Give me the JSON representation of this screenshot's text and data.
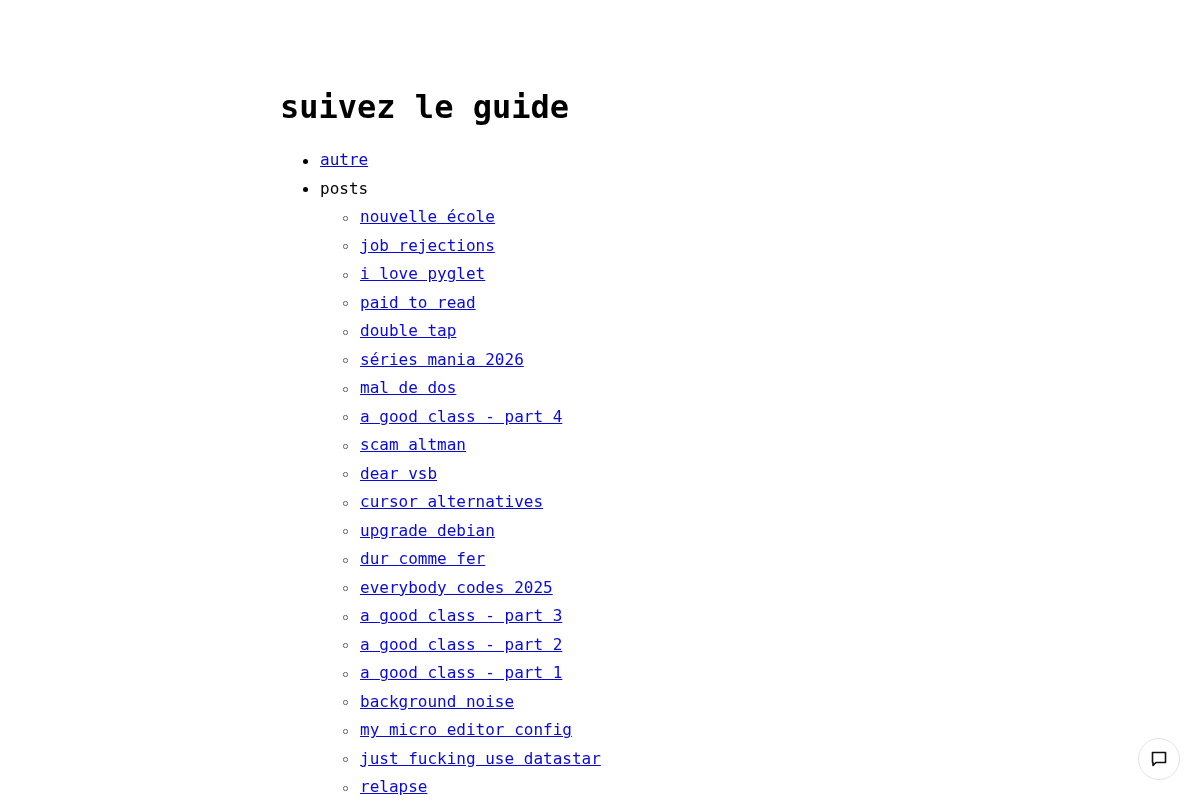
{
  "page": {
    "title": "suivez le guide"
  },
  "nav": [
    {
      "label": "autre",
      "kind": "link"
    },
    {
      "label": "posts",
      "kind": "label",
      "children": [
        {
          "label": "nouvelle école",
          "kind": "link"
        },
        {
          "label": "job rejections",
          "kind": "link"
        },
        {
          "label": "i love pyglet",
          "kind": "link"
        },
        {
          "label": "paid to read",
          "kind": "link"
        },
        {
          "label": "double tap",
          "kind": "link"
        },
        {
          "label": "séries mania 2026",
          "kind": "link"
        },
        {
          "label": "mal de dos",
          "kind": "link"
        },
        {
          "label": "a good class - part 4",
          "kind": "link"
        },
        {
          "label": "scam altman",
          "kind": "link"
        },
        {
          "label": "dear vsb",
          "kind": "link"
        },
        {
          "label": "cursor alternatives",
          "kind": "link"
        },
        {
          "label": "upgrade debian",
          "kind": "link"
        },
        {
          "label": "dur comme fer",
          "kind": "link"
        },
        {
          "label": "everybody codes 2025",
          "kind": "link"
        },
        {
          "label": "a good class - part 3",
          "kind": "link"
        },
        {
          "label": "a good class - part 2",
          "kind": "link"
        },
        {
          "label": "a good class - part 1",
          "kind": "link"
        },
        {
          "label": "background noise",
          "kind": "link"
        },
        {
          "label": "my micro editor config",
          "kind": "link"
        },
        {
          "label": "just fucking use datastar",
          "kind": "link"
        },
        {
          "label": "relapse",
          "kind": "link"
        }
      ]
    }
  ]
}
